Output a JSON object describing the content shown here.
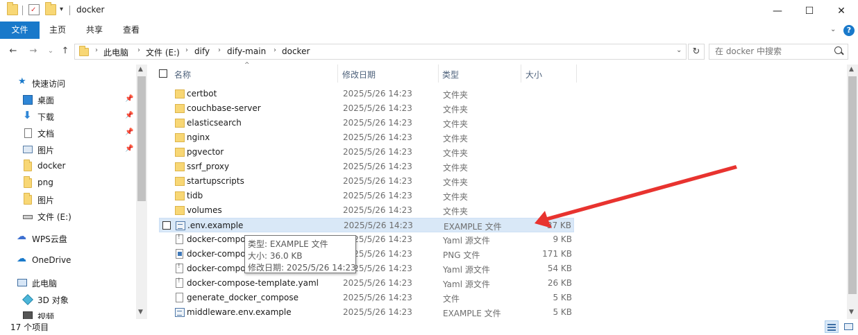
{
  "window": {
    "title": "docker",
    "minimize_glyph": "—",
    "maximize_glyph": "☐",
    "close_glyph": "✕"
  },
  "ribbon": {
    "tabs": [
      {
        "label": "文件",
        "active": true
      },
      {
        "label": "主页",
        "active": false
      },
      {
        "label": "共享",
        "active": false
      },
      {
        "label": "查看",
        "active": false
      }
    ],
    "help_glyph": "?"
  },
  "nav": {
    "back_glyph": "←",
    "forward_glyph": "→",
    "recent_glyph": "⌄",
    "up_glyph": "↑",
    "breadcrumb": [
      "此电脑",
      "文件 (E:)",
      "dify",
      "dify-main",
      "docker"
    ],
    "refresh_glyph": "↻",
    "search_placeholder": "在 docker 中搜索"
  },
  "sidebar": {
    "items": [
      {
        "label": "快速访问",
        "icon": "star-icon",
        "pinned": false
      },
      {
        "label": "桌面",
        "icon": "desktop-icon",
        "pinned": true
      },
      {
        "label": "下载",
        "icon": "download-icon",
        "pinned": true
      },
      {
        "label": "文档",
        "icon": "document-icon",
        "pinned": true
      },
      {
        "label": "图片",
        "icon": "pictures-icon",
        "pinned": true
      },
      {
        "label": "docker",
        "icon": "folder-icon",
        "pinned": false
      },
      {
        "label": "png",
        "icon": "folder-icon",
        "pinned": false
      },
      {
        "label": "图片",
        "icon": "folder-icon",
        "pinned": false
      },
      {
        "label": "文件 (E:)",
        "icon": "drive-icon",
        "pinned": false
      },
      {
        "label": "WPS云盘",
        "icon": "cloud-icon",
        "pinned": false
      },
      {
        "label": "OneDrive",
        "icon": "onedrive-icon",
        "pinned": false
      },
      {
        "label": "此电脑",
        "icon": "computer-icon",
        "pinned": false
      },
      {
        "label": "3D 对象",
        "icon": "cube-icon",
        "pinned": false
      },
      {
        "label": "视频",
        "icon": "video-icon",
        "pinned": false
      }
    ]
  },
  "columns": {
    "name": "名称",
    "date": "修改日期",
    "type": "类型",
    "size": "大小"
  },
  "files": [
    {
      "name": "certbot",
      "date": "2025/5/26 14:23",
      "type": "文件夹",
      "size": "",
      "kind": "folder"
    },
    {
      "name": "couchbase-server",
      "date": "2025/5/26 14:23",
      "type": "文件夹",
      "size": "",
      "kind": "folder"
    },
    {
      "name": "elasticsearch",
      "date": "2025/5/26 14:23",
      "type": "文件夹",
      "size": "",
      "kind": "folder"
    },
    {
      "name": "nginx",
      "date": "2025/5/26 14:23",
      "type": "文件夹",
      "size": "",
      "kind": "folder"
    },
    {
      "name": "pgvector",
      "date": "2025/5/26 14:23",
      "type": "文件夹",
      "size": "",
      "kind": "folder"
    },
    {
      "name": "ssrf_proxy",
      "date": "2025/5/26 14:23",
      "type": "文件夹",
      "size": "",
      "kind": "folder"
    },
    {
      "name": "startupscripts",
      "date": "2025/5/26 14:23",
      "type": "文件夹",
      "size": "",
      "kind": "folder"
    },
    {
      "name": "tidb",
      "date": "2025/5/26 14:23",
      "type": "文件夹",
      "size": "",
      "kind": "folder"
    },
    {
      "name": "volumes",
      "date": "2025/5/26 14:23",
      "type": "文件夹",
      "size": "",
      "kind": "folder"
    },
    {
      "name": ".env.example",
      "date": "2025/5/26 14:23",
      "type": "EXAMPLE 文件",
      "size": "37 KB",
      "kind": "env",
      "selected": true
    },
    {
      "name": "docker-compo",
      "date": "2025/5/26 14:23",
      "type": "Yaml 源文件",
      "size": "9 KB",
      "kind": "yaml"
    },
    {
      "name": "docker-compo",
      "date": "2025/5/26 14:23",
      "type": "PNG 文件",
      "size": "171 KB",
      "kind": "png"
    },
    {
      "name": "docker-compo",
      "date": "2025/5/26 14:23",
      "type": "Yaml 源文件",
      "size": "54 KB",
      "kind": "yaml"
    },
    {
      "name": "docker-compose-template.yaml",
      "date": "2025/5/26 14:23",
      "type": "Yaml 源文件",
      "size": "26 KB",
      "kind": "yaml"
    },
    {
      "name": "generate_docker_compose",
      "date": "2025/5/26 14:23",
      "type": "文件",
      "size": "5 KB",
      "kind": "file"
    },
    {
      "name": "middleware.env.example",
      "date": "2025/5/26 14:23",
      "type": "EXAMPLE 文件",
      "size": "5 KB",
      "kind": "env"
    }
  ],
  "tooltip": {
    "type_line": "类型: EXAMPLE 文件",
    "size_line": "大小: 36.0 KB",
    "date_line": "修改日期: 2025/5/26 14:23"
  },
  "status": {
    "item_count": "17 个项目"
  },
  "annotation": {
    "arrow_color": "#e8332f"
  }
}
